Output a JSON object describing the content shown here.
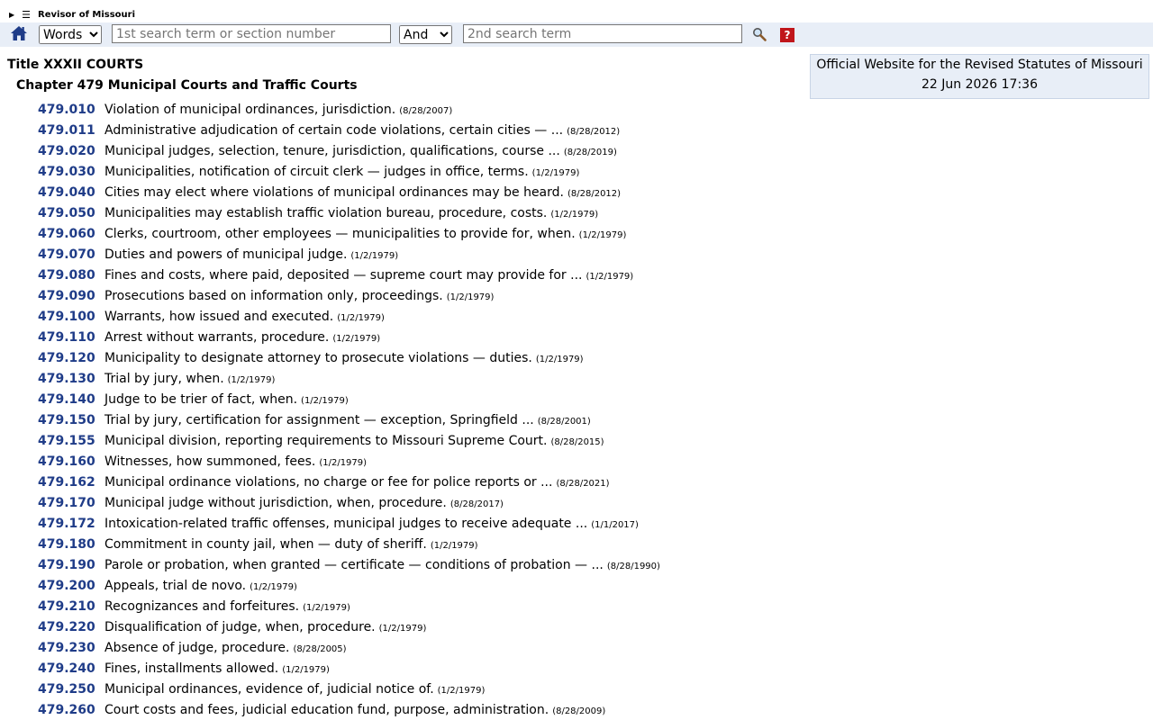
{
  "header": {
    "brand": "Revisor of Missouri",
    "expand_glyph": "▶",
    "menu_glyph": "☰"
  },
  "search": {
    "mode_value": "Words",
    "term1_placeholder": "1st search term or section number",
    "operator_value": "And",
    "term2_placeholder": "2nd search term",
    "help_label": "?"
  },
  "icons": {
    "home": "home-icon",
    "search": "search-icon",
    "help": "help-icon"
  },
  "colors": {
    "link": "#1f3c88",
    "toolbar_bg": "#e8eef7",
    "help_bg": "#c0161b",
    "home": "#1f3c88"
  },
  "page": {
    "title": "Title XXXII COURTS",
    "chapter": "Chapter 479 Municipal Courts and Traffic Courts"
  },
  "infobox": {
    "line1": "Official Website for the Revised Statutes of Missouri",
    "line2": "22 Jun 2026 17:36"
  },
  "sections": [
    {
      "number": "479.010",
      "title": "Violation of municipal ordinances, jurisdiction.",
      "date": "(8/28/2007)"
    },
    {
      "number": "479.011",
      "title": "Administrative adjudication of certain code violations, certain cities — ...",
      "date": "(8/28/2012)"
    },
    {
      "number": "479.020",
      "title": "Municipal judges, selection, tenure, jurisdiction, qualifications, course ...",
      "date": "(8/28/2019)"
    },
    {
      "number": "479.030",
      "title": "Municipalities, notification of circuit clerk — judges in office, terms.",
      "date": "(1/2/1979)"
    },
    {
      "number": "479.040",
      "title": "Cities may elect where violations of municipal ordinances may be heard.",
      "date": "(8/28/2012)"
    },
    {
      "number": "479.050",
      "title": "Municipalities may establish traffic violation bureau, procedure, costs.",
      "date": "(1/2/1979)"
    },
    {
      "number": "479.060",
      "title": "Clerks, courtroom, other employees — municipalities to provide for, when.",
      "date": "(1/2/1979)"
    },
    {
      "number": "479.070",
      "title": "Duties and powers of municipal judge.",
      "date": "(1/2/1979)"
    },
    {
      "number": "479.080",
      "title": "Fines and costs, where paid, deposited — supreme court may provide for ...",
      "date": "(1/2/1979)"
    },
    {
      "number": "479.090",
      "title": "Prosecutions based on information only, proceedings.",
      "date": "(1/2/1979)"
    },
    {
      "number": "479.100",
      "title": "Warrants, how issued and executed.",
      "date": "(1/2/1979)"
    },
    {
      "number": "479.110",
      "title": "Arrest without warrants, procedure.",
      "date": "(1/2/1979)"
    },
    {
      "number": "479.120",
      "title": "Municipality to designate attorney to prosecute violations — duties.",
      "date": "(1/2/1979)"
    },
    {
      "number": "479.130",
      "title": "Trial by jury, when.",
      "date": "(1/2/1979)"
    },
    {
      "number": "479.140",
      "title": "Judge to be trier of fact, when.",
      "date": "(1/2/1979)"
    },
    {
      "number": "479.150",
      "title": "Trial by jury, certification for assignment — exception, Springfield ...",
      "date": "(8/28/2001)"
    },
    {
      "number": "479.155",
      "title": "Municipal division, reporting requirements to Missouri Supreme Court.",
      "date": "(8/28/2015)"
    },
    {
      "number": "479.160",
      "title": "Witnesses, how summoned, fees.",
      "date": "(1/2/1979)"
    },
    {
      "number": "479.162",
      "title": "Municipal ordinance violations, no charge or fee for police reports or ...",
      "date": "(8/28/2021)"
    },
    {
      "number": "479.170",
      "title": "Municipal judge without jurisdiction, when, procedure.",
      "date": "(8/28/2017)"
    },
    {
      "number": "479.172",
      "title": "Intoxication-related traffic offenses, municipal judges to receive adequate ...",
      "date": "(1/1/2017)"
    },
    {
      "number": "479.180",
      "title": "Commitment in county jail, when — duty of sheriff.",
      "date": "(1/2/1979)"
    },
    {
      "number": "479.190",
      "title": "Parole or probation, when granted — certificate — conditions of probation — ...",
      "date": "(8/28/1990)"
    },
    {
      "number": "479.200",
      "title": "Appeals, trial de novo.",
      "date": "(1/2/1979)"
    },
    {
      "number": "479.210",
      "title": "Recognizances and forfeitures.",
      "date": "(1/2/1979)"
    },
    {
      "number": "479.220",
      "title": "Disqualification of judge, when, procedure.",
      "date": "(1/2/1979)"
    },
    {
      "number": "479.230",
      "title": "Absence of judge, procedure.",
      "date": "(8/28/2005)"
    },
    {
      "number": "479.240",
      "title": "Fines, installments allowed.",
      "date": "(1/2/1979)"
    },
    {
      "number": "479.250",
      "title": "Municipal ordinances, evidence of, judicial notice of.",
      "date": "(1/2/1979)"
    },
    {
      "number": "479.260",
      "title": "Court costs and fees, judicial education fund, purpose, administration.",
      "date": "(8/28/2009)"
    }
  ]
}
